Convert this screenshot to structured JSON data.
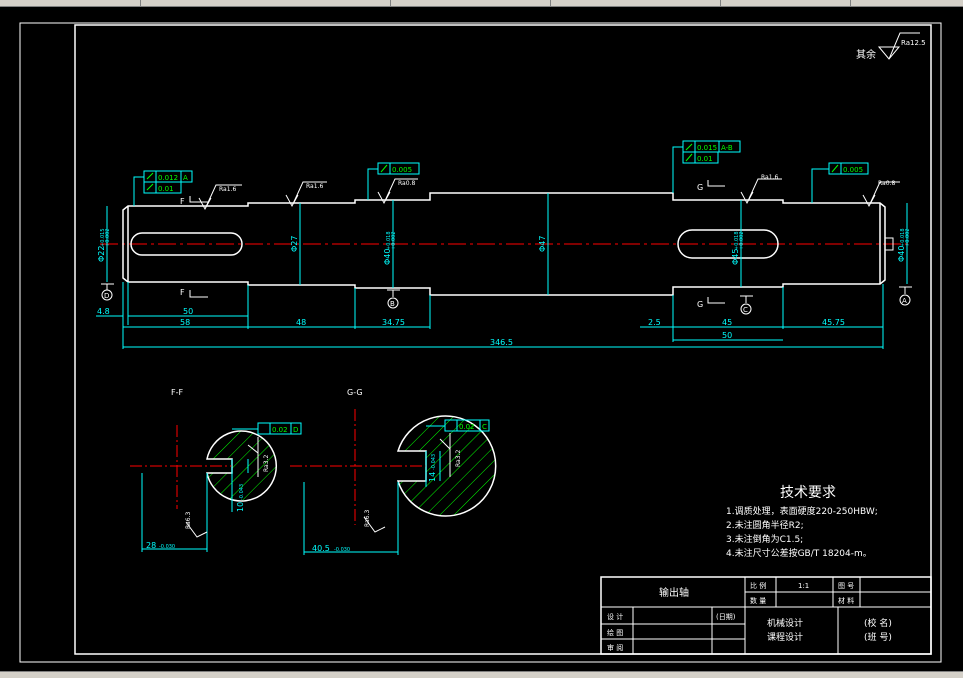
{
  "colors": {
    "background": "#000000",
    "outline": "#ffffff",
    "dimension": "#00ffff",
    "centerline": "#ff0000",
    "hatch": "#00ff00",
    "tolerance": "#00ff00",
    "ui_chrome": "#d4d0c8"
  },
  "roughness": {
    "other": "其余",
    "global_value": "Ra12.5",
    "r16": "Ra1.6",
    "r08": "Ra0.8",
    "r32": "Ra3.2",
    "r63": "Ra6.3"
  },
  "tolerances": {
    "tol1_runout": "0.012",
    "tol1_ref": "A",
    "tol2_cyl": "0.01",
    "tol3_cyl": "0.005",
    "tol4_runout": "0.015",
    "tol4_ref": "A-B",
    "tol5_cyl": "0.01",
    "tol6_cyl": "0.005",
    "tol7_sym": "0.02",
    "tol7_ref": "D",
    "tol8_sym": "0.02",
    "tol8_ref": "C"
  },
  "dims": {
    "d22": "Φ22",
    "d22_tol_up": "+0.015",
    "d22_tol_dn": "+0.002",
    "d27": "Φ27",
    "d40a": "Φ40",
    "d40a_tol_up": "+0.018",
    "d40a_tol_dn": "+0.002",
    "d47": "Φ47",
    "d45": "Φ45",
    "d45_tol_up": "+0.018",
    "d45_tol_dn": "+0.002",
    "d40b": "Φ40",
    "d40b_tol_up": "+0.018",
    "d40b_tol_dn": "+0.002",
    "len_4_8": "4.8",
    "len_50a": "50",
    "len_58": "58",
    "len_48": "48",
    "len_34_75": "34.75",
    "len_2_5": "2.5",
    "len_45": "45",
    "len_45_75": "45.75",
    "len_50b": "50",
    "len_346_5": "346.5",
    "w28": "28",
    "w28_tol": "-0.030",
    "w40_5": "40.5",
    "w40_5_tol": "-0.030",
    "w10": "10",
    "w10_tol": "-0.043",
    "w14": "14",
    "w14_tol": "-0.043"
  },
  "datums": {
    "a": "A",
    "b": "B",
    "c": "C",
    "d": "D"
  },
  "section_markers": {
    "f": "F",
    "g": "G"
  },
  "sections": {
    "ff": "F-F",
    "gg": "G-G"
  },
  "tech_req": {
    "title": "技术要求",
    "items": [
      "1.调质处理，表面硬度220-250HBW;",
      "2.未注圆角半径R2;",
      "3.未注倒角为C1.5;",
      "4.未注尺寸公差按GB/T 18204-m。"
    ]
  },
  "title_block": {
    "part_name": "输出轴",
    "scale_label": "比 例",
    "scale_value": "1:1",
    "drawing_no_label": "图 号",
    "qty_label": "数 量",
    "material_label": "材 料",
    "design_label": "设 计",
    "draw_label": "绘 图",
    "review_label": "审 阅",
    "date_label": "(日期)",
    "course1": "机械设计",
    "course2": "课程设计",
    "school": "(校 名)",
    "class": "(班 号)"
  }
}
